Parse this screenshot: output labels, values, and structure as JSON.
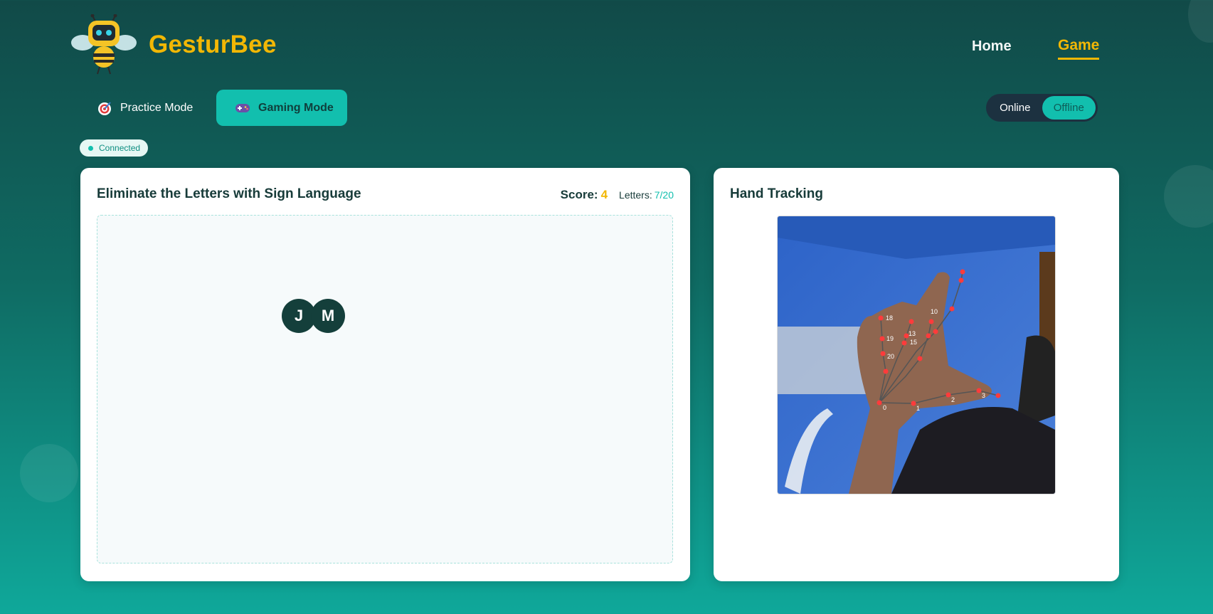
{
  "header": {
    "brand": "GesturBee",
    "nav": {
      "home": "Home",
      "game": "Game"
    }
  },
  "modes": {
    "practice_label": "Practice Mode",
    "gaming_label": "Gaming Mode",
    "practice_icon": "target-icon",
    "gaming_icon": "gamepad-icon",
    "active": "Gaming Mode"
  },
  "connection_toggle": {
    "online_label": "Online",
    "offline_label": "Offline",
    "selected": "Offline"
  },
  "status": {
    "label": "Connected"
  },
  "game_panel": {
    "title": "Eliminate the Letters with Sign Language",
    "score_label": "Score:",
    "score_value": "4",
    "letters_label": "Letters:",
    "letters_value": "7/20",
    "falling_letters": [
      "J",
      "M"
    ]
  },
  "tracking_panel": {
    "title": "Hand Tracking",
    "landmark_labels": [
      "0",
      "1",
      "2",
      "3",
      "10",
      "13",
      "15",
      "18",
      "19",
      "20"
    ]
  },
  "colors": {
    "accent": "#12bfae",
    "brand_yellow": "#f2b705",
    "dark_teal": "#143f3b",
    "landmark_red": "#ff3b3b"
  }
}
